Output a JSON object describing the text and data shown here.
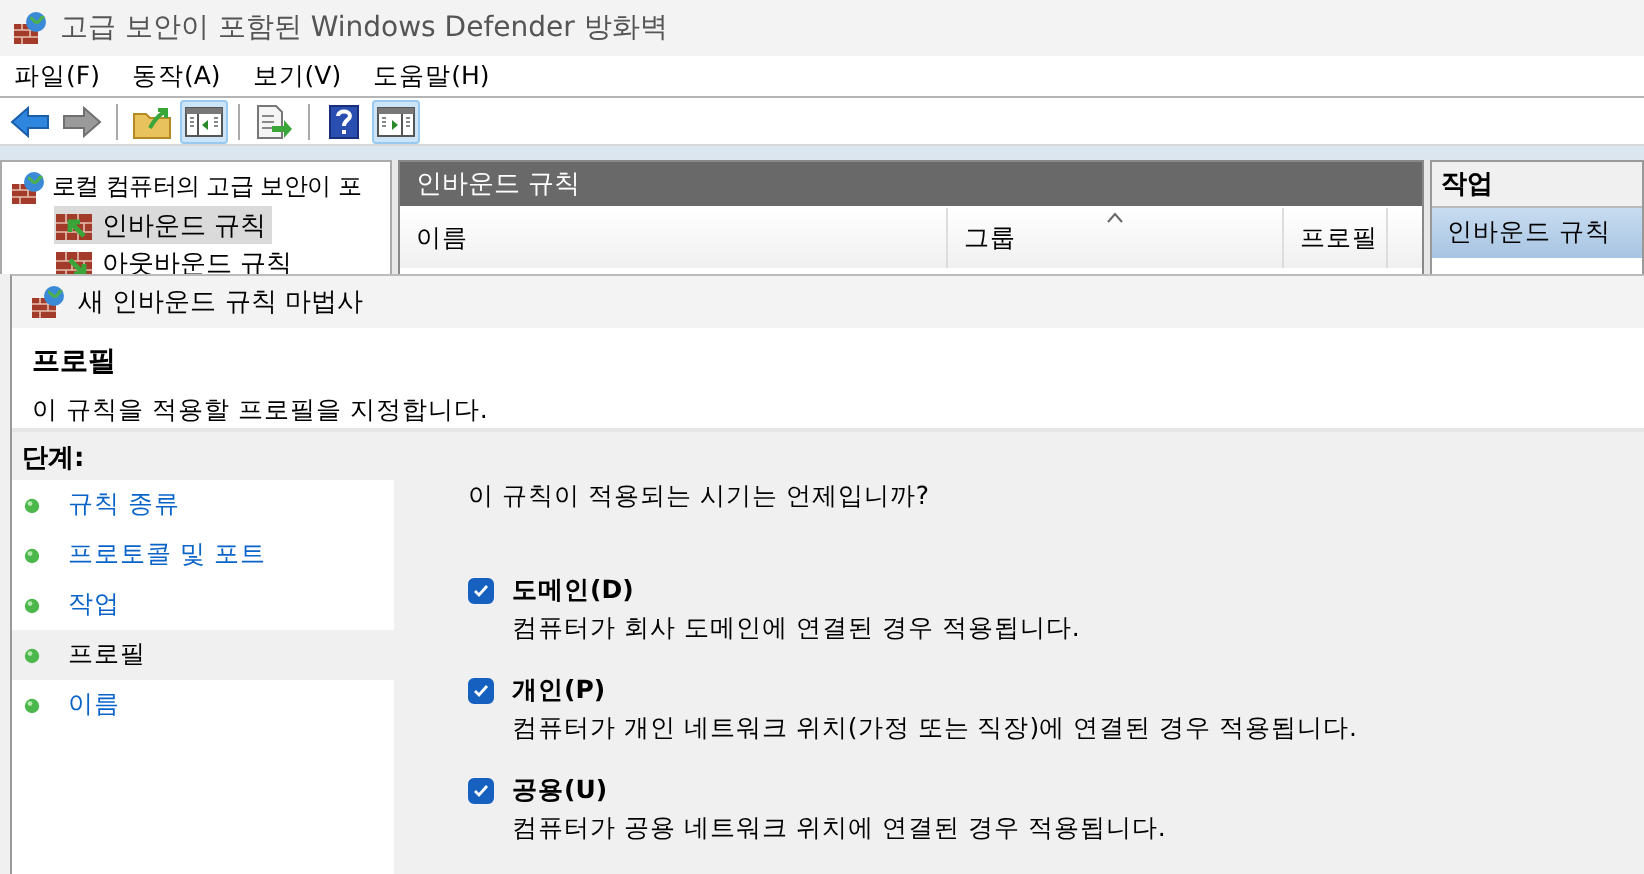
{
  "window": {
    "title": "고급 보안이 포함된 Windows Defender 방화벽"
  },
  "menu": [
    "파일(F)",
    "동작(A)",
    "보기(V)",
    "도움말(H)"
  ],
  "toolbar": [
    {
      "kind": "back",
      "pressed": false
    },
    {
      "kind": "forward",
      "pressed": false
    },
    {
      "kind": "separator"
    },
    {
      "kind": "folder-up",
      "pressed": false
    },
    {
      "kind": "panel-left",
      "pressed": true
    },
    {
      "kind": "separator"
    },
    {
      "kind": "export",
      "pressed": false
    },
    {
      "kind": "separator"
    },
    {
      "kind": "help",
      "pressed": false
    },
    {
      "kind": "panel-right",
      "pressed": true
    }
  ],
  "tree": {
    "root": "로컬 컴퓨터의 고급 보안이 포",
    "children": [
      {
        "label": "인바운드 규칙",
        "selected": true
      },
      {
        "label": "아웃바운드 규칙",
        "selected": false
      }
    ]
  },
  "rules_panel": {
    "title": "인바운드 규칙",
    "columns": [
      {
        "label": "이름",
        "sorted": false
      },
      {
        "label": "그룹",
        "sorted": true
      },
      {
        "label": "프로필",
        "sorted": false
      }
    ]
  },
  "actions": {
    "title": "작업",
    "items": [
      {
        "label": "인바운드 규칙",
        "selected": true
      }
    ]
  },
  "dialog": {
    "title": "새 인바운드 규칙 마법사",
    "heading": "프로필",
    "description": "이 규칙을 적용할 프로필을 지정합니다.",
    "steps_title": "단계:",
    "steps": [
      {
        "label": "규칙 종류",
        "selected": false
      },
      {
        "label": "프로토콜 및 포트",
        "selected": false
      },
      {
        "label": "작업",
        "selected": false
      },
      {
        "label": "프로필",
        "selected": true
      },
      {
        "label": "이름",
        "selected": false
      }
    ],
    "question": "이 규칙이 적용되는 시기는 언제입니까?",
    "options": [
      {
        "label": "도메인(D)",
        "description": "컴퓨터가 회사 도메인에 연결된 경우 적용됩니다.",
        "checked": true
      },
      {
        "label": "개인(P)",
        "description": "컴퓨터가 개인 네트워크 위치(가정 또는 직장)에 연결된 경우 적용됩니다.",
        "checked": true
      },
      {
        "label": "공용(U)",
        "description": "컴퓨터가 공용 네트워크 위치에 연결된 경우 적용됩니다.",
        "checked": true
      }
    ]
  }
}
